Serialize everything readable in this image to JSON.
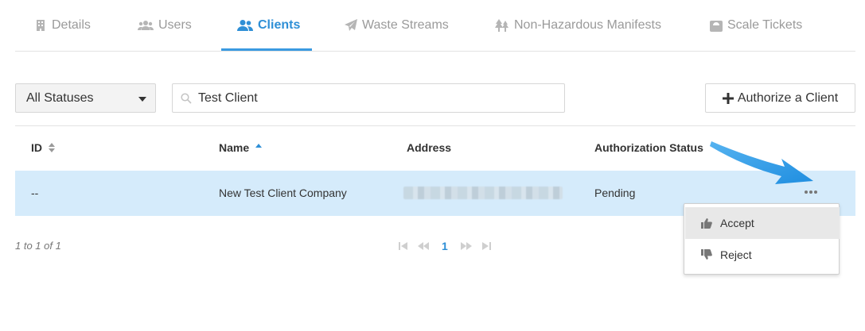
{
  "tabs": [
    {
      "label": "Details",
      "icon": "building-icon",
      "active": false
    },
    {
      "label": "Users",
      "icon": "users-icon",
      "active": false
    },
    {
      "label": "Clients",
      "icon": "clients-icon",
      "active": true
    },
    {
      "label": "Waste Streams",
      "icon": "paper-plane-icon",
      "active": false
    },
    {
      "label": "Non-Hazardous Manifests",
      "icon": "trees-icon",
      "active": false
    },
    {
      "label": "Scale Tickets",
      "icon": "scale-icon",
      "active": false
    }
  ],
  "toolbar": {
    "status_select": "All Statuses",
    "search_value": "Test Client",
    "authorize_label": "Authorize a Client"
  },
  "table": {
    "columns": [
      {
        "label": "ID",
        "sort": "none"
      },
      {
        "label": "Name",
        "sort": "asc"
      },
      {
        "label": "Address",
        "sort": ""
      },
      {
        "label": "Authorization Status",
        "sort": ""
      }
    ],
    "rows": [
      {
        "id": "--",
        "name": "New Test Client Company",
        "address": "",
        "status": "Pending"
      }
    ]
  },
  "row_menu": {
    "items": [
      {
        "label": "Accept",
        "icon": "thumbs-up-icon"
      },
      {
        "label": "Reject",
        "icon": "thumbs-down-icon"
      }
    ]
  },
  "footer": {
    "count_text": "1 to 1 of 1",
    "current_page": "1"
  },
  "colors": {
    "accent": "#2e8fd6",
    "selected_row": "#d5ebfb",
    "annotation_arrow": "#2d9be8"
  }
}
